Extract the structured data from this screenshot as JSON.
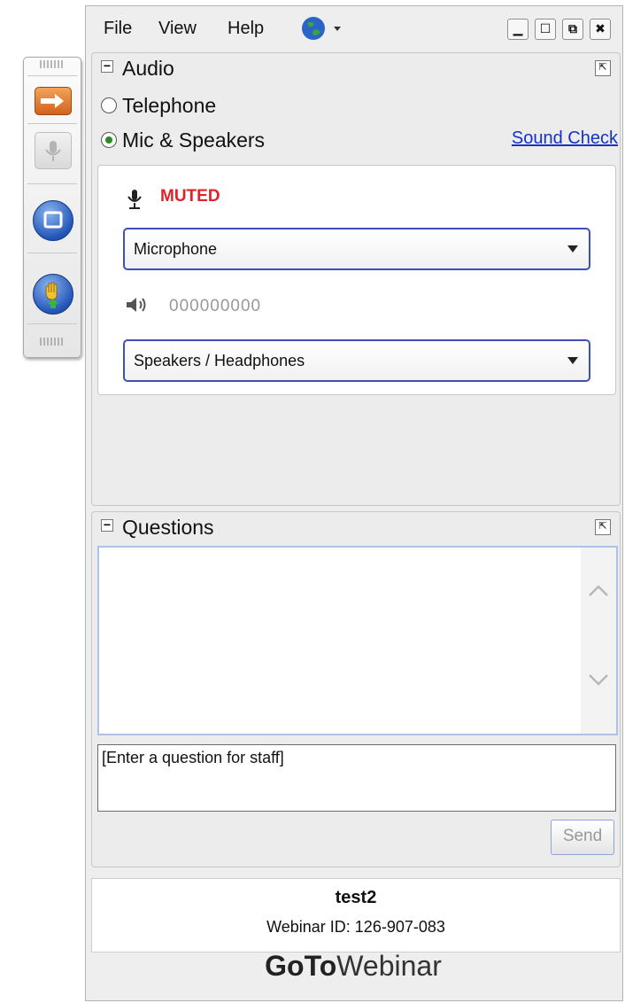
{
  "menu": {
    "file": "File",
    "view": "View",
    "help": "Help",
    "language_icon": "globe-icon",
    "window_controls": [
      "minimize-icon",
      "restore-icon",
      "popout-icon",
      "close-icon"
    ]
  },
  "toolbar": {
    "buttons": [
      "show-hide-control-panel-arrow-icon",
      "microphone-icon",
      "screen-icon",
      "raise-hand-icon"
    ]
  },
  "audio": {
    "title": "Audio",
    "telephone_label": "Telephone",
    "mic_label": "Mic & Speakers",
    "selected": "Mic & Speakers",
    "sound_check": "Sound Check",
    "mic_status": "MUTED",
    "mic_status_color": "#e0222a",
    "microphone_select": "Microphone",
    "speaker_level": "000000000",
    "speaker_select": "Speakers / Headphones"
  },
  "questions": {
    "title": "Questions",
    "input_placeholder": "[Enter a question for staff]",
    "send_label": "Send"
  },
  "session": {
    "name": "test2",
    "webinar_id": "Webinar ID: 126-907-083"
  },
  "brand": {
    "goto": "GoTo",
    "webinar": "Webinar"
  },
  "colors": {
    "accent_blue": "#3d4fb8",
    "link_blue": "#1432c8",
    "toolbar_orange": "#d3621b"
  }
}
